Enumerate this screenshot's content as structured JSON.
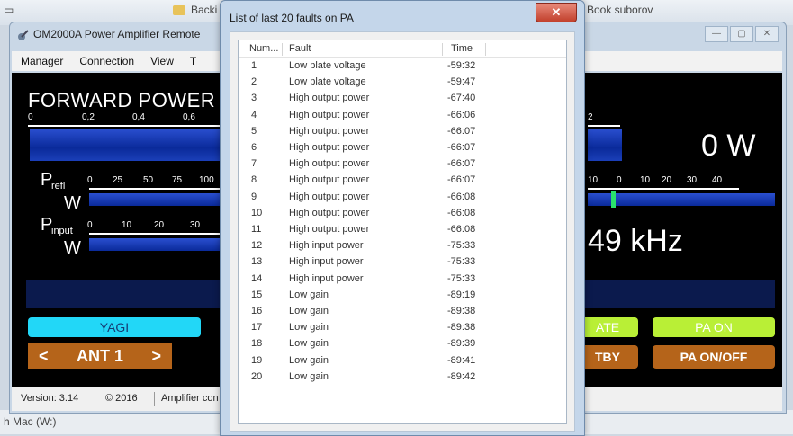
{
  "desktop": {
    "top_left": "Backi",
    "top_right": "Book suborov",
    "bottom_left": "h Mac (W:)"
  },
  "main_window": {
    "title": "OM2000A Power Amplifier Remote",
    "controls": [
      "—",
      "▢",
      "✕"
    ],
    "menu": [
      "Manager",
      "Connection",
      "View",
      "T"
    ],
    "forward_power": {
      "label": "FORWARD POWER",
      "ticks": [
        "0",
        "0,2",
        "0,4",
        "0,6"
      ],
      "right_tick": "2",
      "value": "0 W"
    },
    "pref": {
      "symbol": "P",
      "subscript": "refl",
      "unit": "W",
      "ticks": [
        "0",
        "25",
        "50",
        "75",
        "100"
      ]
    },
    "pinput": {
      "symbol": "P",
      "subscript": "input",
      "unit": "W",
      "ticks": [
        "0",
        "10",
        "20",
        "30"
      ]
    },
    "right_scale_ticks": [
      "10",
      "0",
      "10",
      "20",
      "30",
      "40"
    ],
    "frequency": "49 kHz",
    "buttons": {
      "antenna_type": "YAGI",
      "antenna": "ANT 1",
      "ant_prev": "<",
      "ant_next": ">",
      "operate": "ATE",
      "pa_on": "PA ON",
      "standby": "TBY",
      "pa_onoff": "PA ON/OFF"
    },
    "status": {
      "version": "Version: 3.14",
      "copyright": "© 2016",
      "amplifier": "Amplifier con"
    }
  },
  "dialog": {
    "title": "List of last 20 faults on PA",
    "close": "✕",
    "columns": [
      "Num...",
      "Fault",
      "Time"
    ],
    "rows": [
      {
        "num": "1",
        "fault": "Low plate voltage",
        "time": "-59:32"
      },
      {
        "num": "2",
        "fault": "Low plate voltage",
        "time": "-59:47"
      },
      {
        "num": "3",
        "fault": "High output power",
        "time": "-67:40"
      },
      {
        "num": "4",
        "fault": "High output power",
        "time": "-66:06"
      },
      {
        "num": "5",
        "fault": "High output power",
        "time": "-66:07"
      },
      {
        "num": "6",
        "fault": "High output power",
        "time": "-66:07"
      },
      {
        "num": "7",
        "fault": "High output power",
        "time": "-66:07"
      },
      {
        "num": "8",
        "fault": "High output power",
        "time": "-66:07"
      },
      {
        "num": "9",
        "fault": "High output power",
        "time": "-66:08"
      },
      {
        "num": "10",
        "fault": "High output power",
        "time": "-66:08"
      },
      {
        "num": "11",
        "fault": "High output power",
        "time": "-66:08"
      },
      {
        "num": "12",
        "fault": "High input power",
        "time": "-75:33"
      },
      {
        "num": "13",
        "fault": "High input power",
        "time": "-75:33"
      },
      {
        "num": "14",
        "fault": "High input power",
        "time": "-75:33"
      },
      {
        "num": "15",
        "fault": "Low gain",
        "time": "-89:19"
      },
      {
        "num": "16",
        "fault": "Low gain",
        "time": "-89:38"
      },
      {
        "num": "17",
        "fault": "Low gain",
        "time": "-89:38"
      },
      {
        "num": "18",
        "fault": "Low gain",
        "time": "-89:39"
      },
      {
        "num": "19",
        "fault": "Low gain",
        "time": "-89:41"
      },
      {
        "num": "20",
        "fault": "Low gain",
        "time": "-89:42"
      }
    ]
  }
}
